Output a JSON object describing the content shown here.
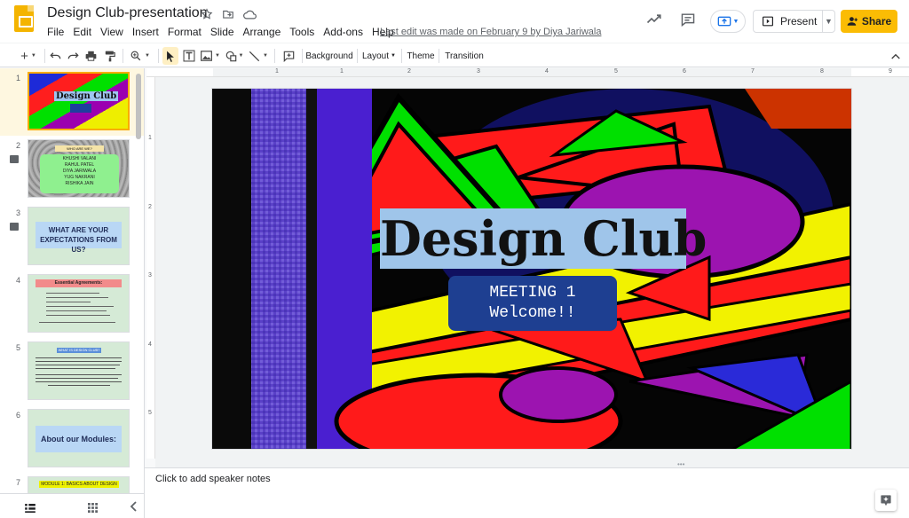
{
  "doc": {
    "title": "Design Club-presentation",
    "last_edit": "Last edit was made on February 9 by Diya Jariwala"
  },
  "menu": [
    "File",
    "Edit",
    "View",
    "Insert",
    "Format",
    "Slide",
    "Arrange",
    "Tools",
    "Add-ons",
    "Help"
  ],
  "header_buttons": {
    "present": "Present",
    "share": "Share"
  },
  "toolbar": {
    "background": "Background",
    "layout": "Layout",
    "theme": "Theme",
    "transition": "Transition"
  },
  "ruler": {
    "h_ticks": [
      "1",
      "1",
      "2",
      "3",
      "4",
      "5",
      "6",
      "7",
      "8",
      "9"
    ],
    "v_ticks": [
      "1",
      "2",
      "3",
      "4",
      "5"
    ]
  },
  "slides": [
    {
      "number": "1",
      "title": "Design Club"
    },
    {
      "number": "2",
      "header": "WHO ARE WE?",
      "names": [
        "KHUSHI VALANI",
        "RAHUL PATEL",
        "DIYA JARIWALA",
        "YUG NAKRANI",
        "RISHIKA JAIN"
      ]
    },
    {
      "number": "3",
      "title": "WHAT ARE YOUR EXPECTATIONS FROM US?"
    },
    {
      "number": "4",
      "title": "Essential Agreements:"
    },
    {
      "number": "5",
      "title": "WHAT IS DESIGN CLUB?"
    },
    {
      "number": "6",
      "title": "About our Modules:"
    },
    {
      "number": "7",
      "title": "MODULE 1: BASICS ABOUT DESIGN"
    }
  ],
  "current_slide": {
    "title": "Design Club",
    "subtitle_line1": "MEETING 1",
    "subtitle_line2": "Welcome!!"
  },
  "notes_placeholder": "Click to add speaker notes",
  "colors": {
    "share": "#fbbc04",
    "selected_slide_border": "#f9ab00",
    "title_bg": "#9fc5ea",
    "subtitle_bg": "#1e3f91"
  }
}
